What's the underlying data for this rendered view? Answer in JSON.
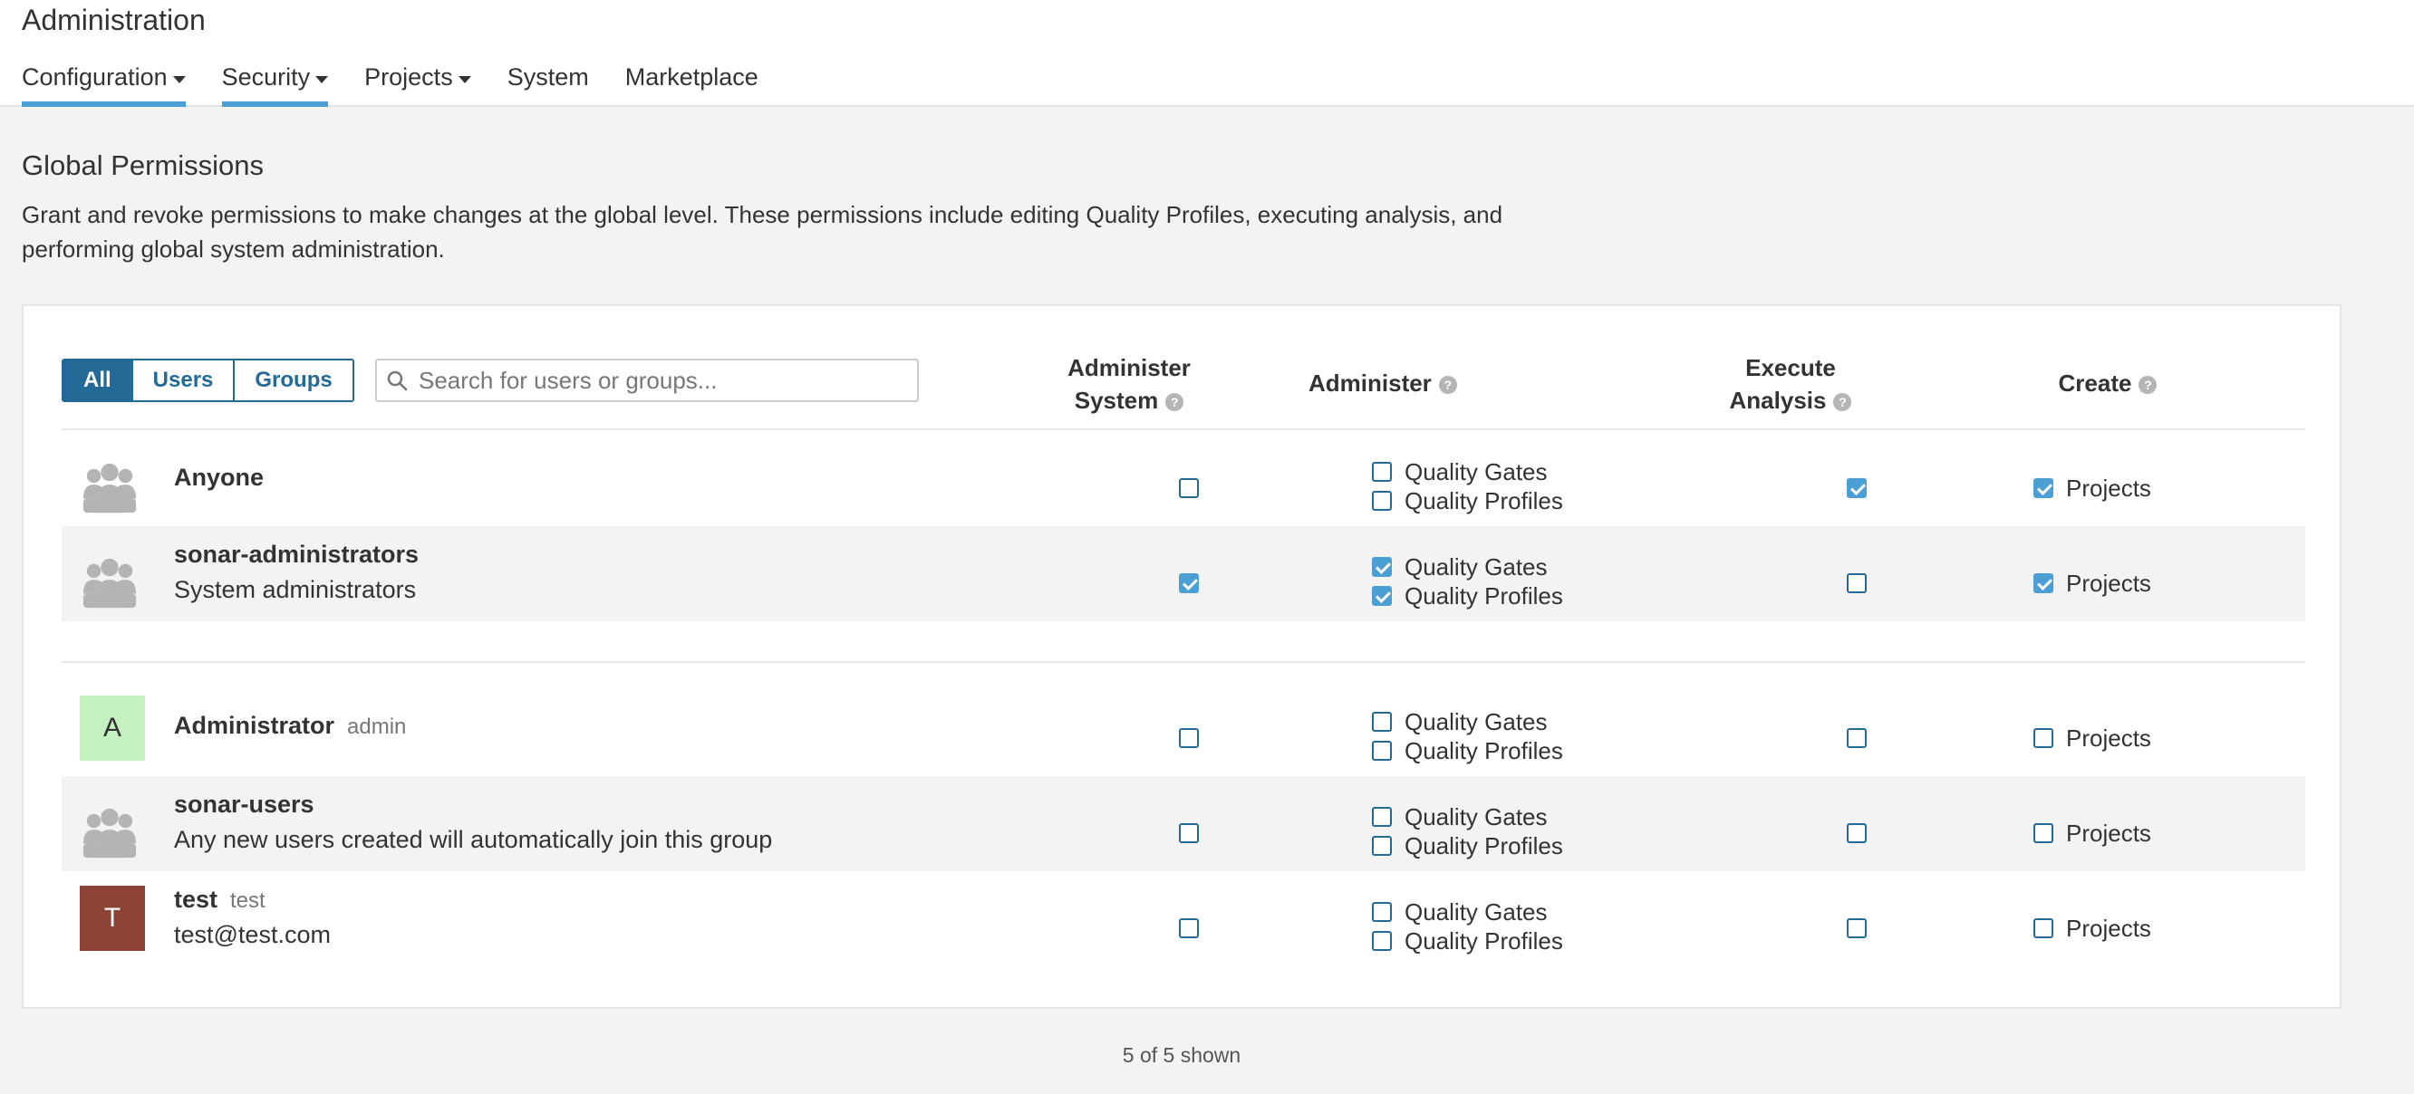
{
  "header": {
    "title": "Administration",
    "nav": [
      {
        "label": "Configuration",
        "dropdown": true,
        "active": true
      },
      {
        "label": "Security",
        "dropdown": true,
        "active": true
      },
      {
        "label": "Projects",
        "dropdown": true,
        "active": false
      },
      {
        "label": "System",
        "dropdown": false,
        "active": false
      },
      {
        "label": "Marketplace",
        "dropdown": false,
        "active": false
      }
    ]
  },
  "page": {
    "title": "Global Permissions",
    "description": "Grant and revoke permissions to make changes at the global level. These permissions include editing Quality Profiles, executing analysis, and performing global system administration."
  },
  "filter": {
    "buttons": [
      "All",
      "Users",
      "Groups"
    ],
    "selected": "All",
    "search_placeholder": "Search for users or groups..."
  },
  "columns": {
    "administer_system": "Administer System",
    "administer": "Administer",
    "execute_analysis": "Execute Analysis",
    "create": "Create",
    "help_glyph": "?"
  },
  "option_labels": {
    "quality_gates": "Quality Gates",
    "quality_profiles": "Quality Profiles",
    "projects": "Projects"
  },
  "rows": [
    {
      "type": "group",
      "name": "Anyone",
      "login": "",
      "description": "",
      "admin_system": false,
      "quality_gates": false,
      "quality_profiles": false,
      "execute_analysis": true,
      "create_projects": true
    },
    {
      "type": "group",
      "name": "sonar-administrators",
      "login": "",
      "description": "System administrators",
      "admin_system": true,
      "quality_gates": true,
      "quality_profiles": true,
      "execute_analysis": false,
      "create_projects": true
    },
    {
      "type": "user",
      "initial": "A",
      "avatar_bg": "#c5f0c0",
      "avatar_fg": "#333333",
      "name": "Administrator",
      "login": "admin",
      "description": "",
      "admin_system": false,
      "quality_gates": false,
      "quality_profiles": false,
      "execute_analysis": false,
      "create_projects": false
    },
    {
      "type": "group",
      "name": "sonar-users",
      "login": "",
      "description": "Any new users created will automatically join this group",
      "admin_system": false,
      "quality_gates": false,
      "quality_profiles": false,
      "execute_analysis": false,
      "create_projects": false
    },
    {
      "type": "user",
      "initial": "T",
      "avatar_bg": "#8c4336",
      "avatar_fg": "#ffffff",
      "name": "test",
      "login": "test",
      "description": "test@test.com",
      "admin_system": false,
      "quality_gates": false,
      "quality_profiles": false,
      "execute_analysis": false,
      "create_projects": false
    }
  ],
  "footer": {
    "shown": "5 of 5 shown"
  },
  "colors": {
    "accent": "#4b9fd5",
    "button_blue": "#236a97"
  }
}
